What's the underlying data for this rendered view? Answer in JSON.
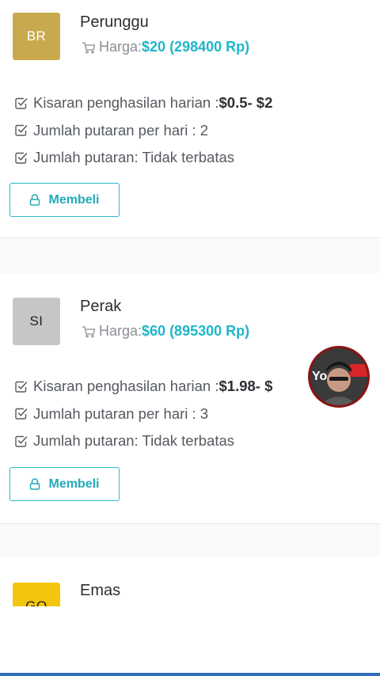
{
  "plans": [
    {
      "initials": "BR",
      "name": "Perunggu",
      "price_label": "Harga:",
      "price_value": "$20 (298400 Rp)",
      "features": {
        "income_label": "Kisaran penghasilan harian : ",
        "income_value": "$0.5- $2",
        "spins_per_day": "Jumlah putaran per hari : 2",
        "spins_total": "Jumlah putaran: Tidak terbatas"
      },
      "buy_label": "Membeli"
    },
    {
      "initials": "SI",
      "name": "Perak",
      "price_label": "Harga:",
      "price_value": "$60 (895300 Rp)",
      "features": {
        "income_label": "Kisaran penghasilan harian : ",
        "income_value": "$1.98- $",
        "spins_per_day": "Jumlah putaran per hari : 3",
        "spins_total": "Jumlah putaran: Tidak terbatas"
      },
      "buy_label": "Membeli"
    },
    {
      "initials": "GO",
      "name": "Emas"
    }
  ],
  "overlay": {
    "label": "Yo"
  },
  "colors": {
    "accent": "#1fb6c9",
    "bronze": "#c9a94e",
    "silver": "#c6c6c6",
    "gold": "#f4c40f"
  },
  "icons": [
    "cart-icon",
    "check-square-icon",
    "lock-icon"
  ]
}
